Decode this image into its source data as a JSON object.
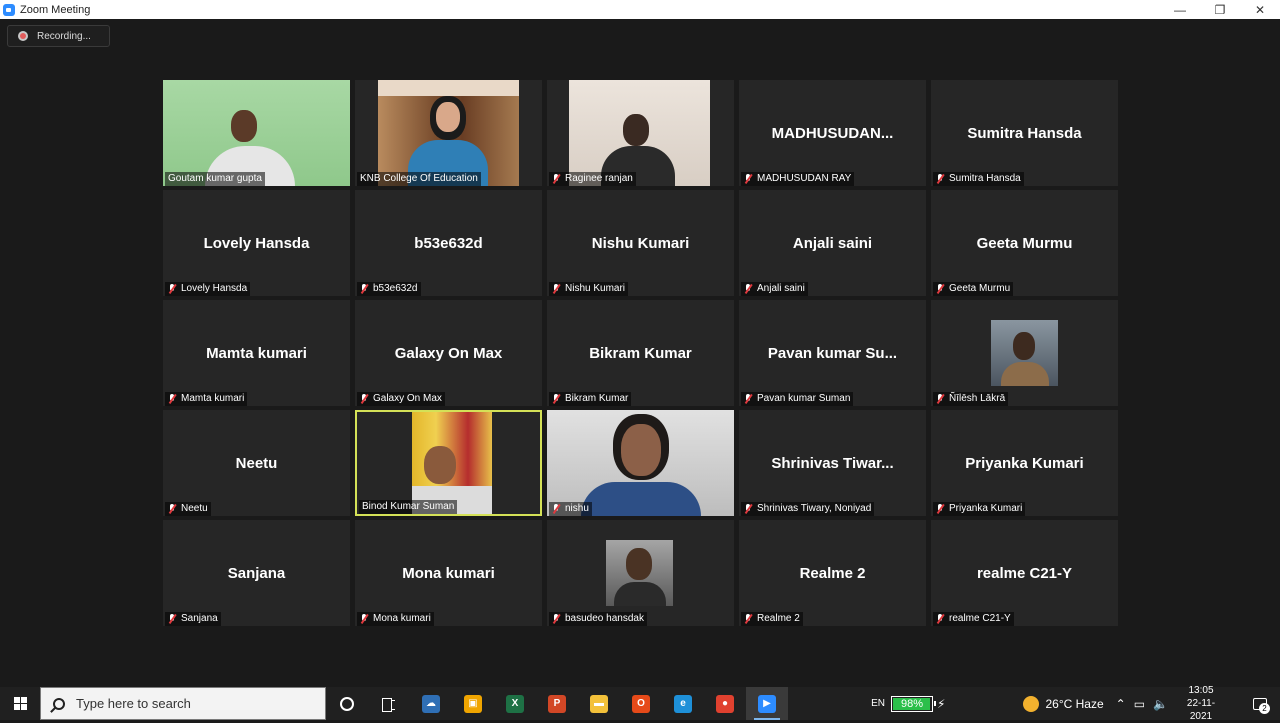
{
  "window": {
    "title": "Zoom Meeting",
    "minimize": "—",
    "maximize": "❐",
    "close": "✕"
  },
  "recording": {
    "label": "Recording..."
  },
  "tiles": [
    {
      "label": "Goutam kumar gupta",
      "display": "",
      "muted": false,
      "video": "goutam"
    },
    {
      "label": "KNB College Of Education",
      "display": "",
      "muted": false,
      "video": "knb"
    },
    {
      "label": "Raginee ranjan",
      "display": "",
      "muted": true,
      "video": "raginee"
    },
    {
      "label": "MADHUSUDAN RAY",
      "display": "MADHUSUDAN...",
      "muted": true
    },
    {
      "label": "Sumitra Hansda",
      "display": "Sumitra Hansda",
      "muted": true
    },
    {
      "label": "Lovely Hansda",
      "display": "Lovely Hansda",
      "muted": true
    },
    {
      "label": "b53e632d",
      "display": "b53e632d",
      "muted": true
    },
    {
      "label": "Nishu Kumari",
      "display": "Nishu Kumari",
      "muted": true
    },
    {
      "label": "Anjali saini",
      "display": "Anjali saini",
      "muted": true
    },
    {
      "label": "Geeta Murmu",
      "display": "Geeta Murmu",
      "muted": true
    },
    {
      "label": "Mamta kumari",
      "display": "Mamta kumari",
      "muted": true
    },
    {
      "label": "Galaxy On Max",
      "display": "Galaxy On Max",
      "muted": true
    },
    {
      "label": "Bikram Kumar",
      "display": "Bikram Kumar",
      "muted": true
    },
    {
      "label": "Pavan kumar Suman",
      "display": "Pavan kumar Su...",
      "muted": true
    },
    {
      "label": "Ñīlēsh Lākrā",
      "display": "",
      "muted": true,
      "video": "nillesh"
    },
    {
      "label": "Neetu",
      "display": "Neetu",
      "muted": true
    },
    {
      "label": "Binod Kumar Suman",
      "display": "",
      "muted": false,
      "video": "binod",
      "speaking": true
    },
    {
      "label": "nishu",
      "display": "",
      "muted": true,
      "video": "nishu"
    },
    {
      "label": "Shrinivas Tiwary, Noniyad",
      "display": "Shrinivas  Tiwar...",
      "muted": true
    },
    {
      "label": "Priyanka Kumari",
      "display": "Priyanka Kumari",
      "muted": true
    },
    {
      "label": "Sanjana",
      "display": "Sanjana",
      "muted": true
    },
    {
      "label": "Mona kumari",
      "display": "Mona kumari",
      "muted": true
    },
    {
      "label": "basudeo hansdak",
      "display": "",
      "muted": true,
      "video": "basudeo"
    },
    {
      "label": "Realme 2",
      "display": "Realme 2",
      "muted": true
    },
    {
      "label": "realme C21-Y",
      "display": "realme C21-Y",
      "muted": true
    }
  ],
  "taskbar": {
    "search_placeholder": "Type here to search",
    "apps": [
      {
        "name": "cortana-icon"
      },
      {
        "name": "task-view-icon"
      },
      {
        "name": "cloud-app-icon",
        "color": "#2f6fb5",
        "glyph": "☁"
      },
      {
        "name": "store-icon",
        "color": "#f0a500",
        "glyph": "▣"
      },
      {
        "name": "excel-icon",
        "color": "#1e7145",
        "glyph": "X"
      },
      {
        "name": "powerpoint-icon",
        "color": "#d24726",
        "glyph": "P"
      },
      {
        "name": "file-explorer-icon",
        "color": "#f3c13a",
        "glyph": "▬"
      },
      {
        "name": "office-icon",
        "color": "#e64a19",
        "glyph": "O"
      },
      {
        "name": "edge-icon",
        "color": "#1e90d8",
        "glyph": "e"
      },
      {
        "name": "chrome-icon",
        "color": "#e0412f",
        "glyph": "●"
      },
      {
        "name": "zoom-icon",
        "color": "#2d8cff",
        "glyph": "▶"
      }
    ],
    "language": "EN",
    "battery": {
      "percent": "98%",
      "level": 0.98
    },
    "weather": "26°C  Haze",
    "time": "13:05",
    "date": "22-11-2021",
    "notifications": "2"
  }
}
